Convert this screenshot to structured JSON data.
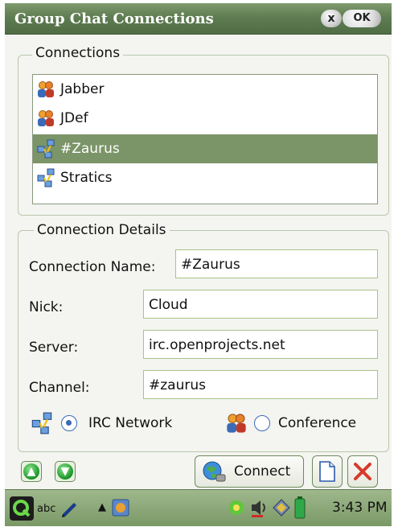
{
  "window": {
    "title": "Group Chat Connections",
    "ok_label": "OK",
    "close_label": "x"
  },
  "connections": {
    "legend": "Connections",
    "items": [
      {
        "label": "Jabber",
        "icon": "group-users-icon",
        "selected": false
      },
      {
        "label": "JDef",
        "icon": "group-users-icon",
        "selected": false
      },
      {
        "label": "#Zaurus",
        "icon": "network-icon",
        "selected": true
      },
      {
        "label": "Stratics",
        "icon": "network-icon",
        "selected": false
      }
    ]
  },
  "details": {
    "legend": "Connection Details",
    "connection_name_label": "Connection Name:",
    "connection_name_value": "#Zaurus",
    "nick_label": "Nick:",
    "nick_value": "Cloud",
    "server_label": "Server:",
    "server_value": "irc.openprojects.net",
    "channel_label": "Channel:",
    "channel_value": "#zaurus",
    "type_irc_label": "IRC Network",
    "type_conference_label": "Conference",
    "selected_type": "IRC Network"
  },
  "actions": {
    "connect_label": "Connect",
    "move_up_icon": "arrow-up-icon",
    "move_down_icon": "arrow-down-icon",
    "new_icon": "new-document-icon",
    "delete_icon": "delete-x-icon"
  },
  "taskbar": {
    "input_mode": "abc",
    "time": "3:43 PM"
  },
  "colors": {
    "titlebar": "#5f7d52",
    "selection": "#7b9468",
    "field_border": "#a9c38a",
    "radio": "#3b6bb5",
    "delete_red": "#d83a2a"
  }
}
